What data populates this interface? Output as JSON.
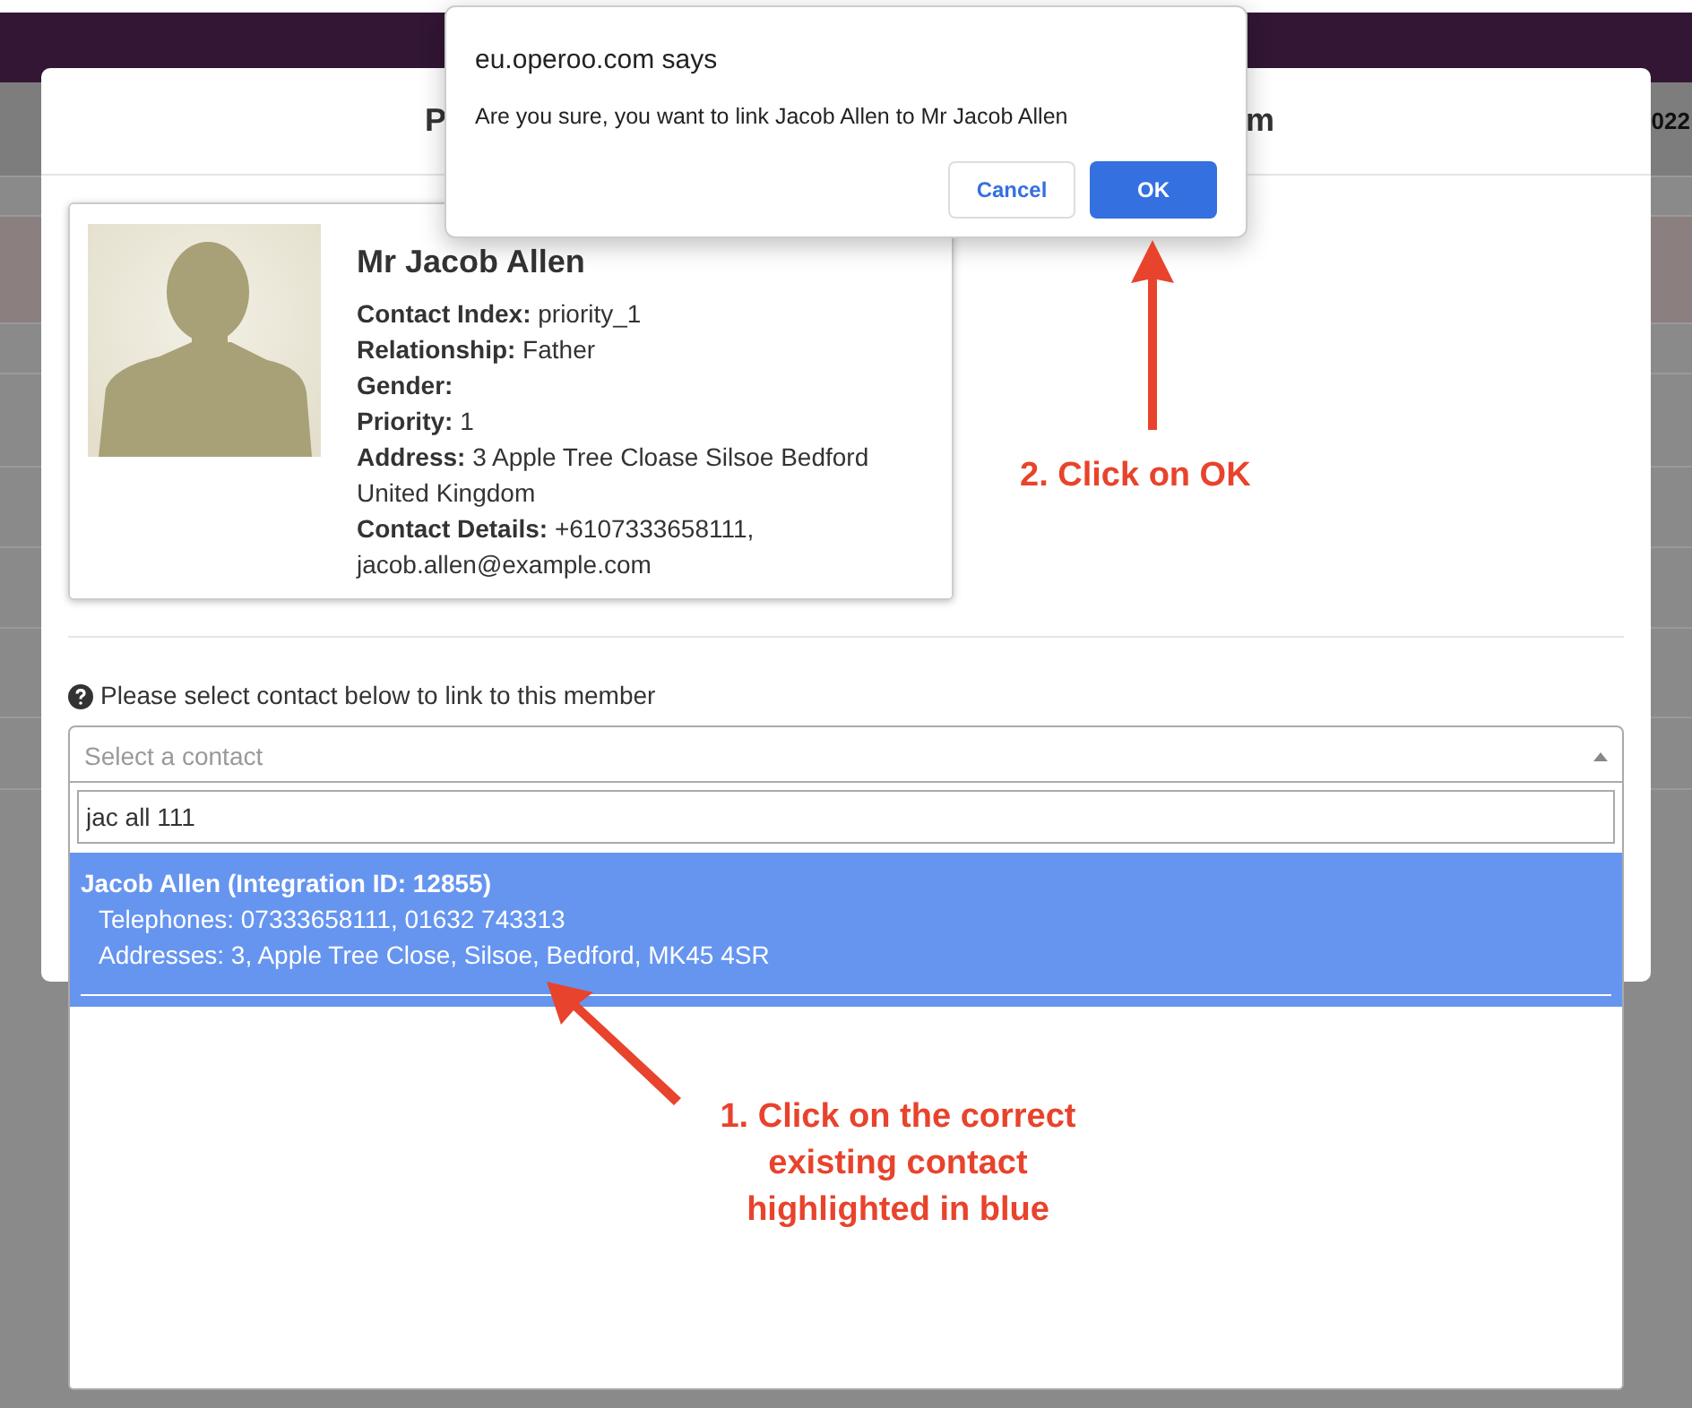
{
  "background": {
    "header_fragment": "022"
  },
  "modal": {
    "title_fragments": [
      "P",
      "m"
    ],
    "contact_card": {
      "name": "Mr Jacob Allen",
      "fields": [
        {
          "label": "Contact Index:",
          "value": "priority_1"
        },
        {
          "label": "Relationship:",
          "value": "Father"
        },
        {
          "label": "Gender:"
        },
        {
          "label": "Priority:",
          "value": "1"
        },
        {
          "label": "Address:",
          "value": "3 Apple Tree Cloase Silsoe Bedford United Kingdom"
        },
        {
          "label": "Contact Details:",
          "value": "+6107333658111, jacob.allen@example.com"
        }
      ]
    },
    "select_prompt": "Please select contact below to link to this member",
    "select": {
      "placeholder": "Select a contact",
      "expanded": true
    },
    "search": {
      "value": "jac all 111"
    },
    "options": [
      {
        "title": "Jacob Allen (Integration ID: 12855)",
        "lines": [
          "Telephones: 07333658111, 01632 743313",
          "Addresses: 3, Apple Tree Close, Silsoe, Bedford, MK45 4SR"
        ],
        "selected": true
      }
    ]
  },
  "dialog": {
    "title": "eu.operoo.com says",
    "message": "Are you sure, you want to link Jacob Allen to Mr Jacob Allen",
    "buttons": [
      {
        "label": "Cancel",
        "kind": "secondary"
      },
      {
        "label": "OK",
        "kind": "primary"
      }
    ]
  },
  "annotations": [
    {
      "lines": [
        "2. Click on OK"
      ]
    },
    {
      "lines": [
        "1. Click on the correct",
        "existing contact",
        "highlighted in blue"
      ]
    }
  ]
}
